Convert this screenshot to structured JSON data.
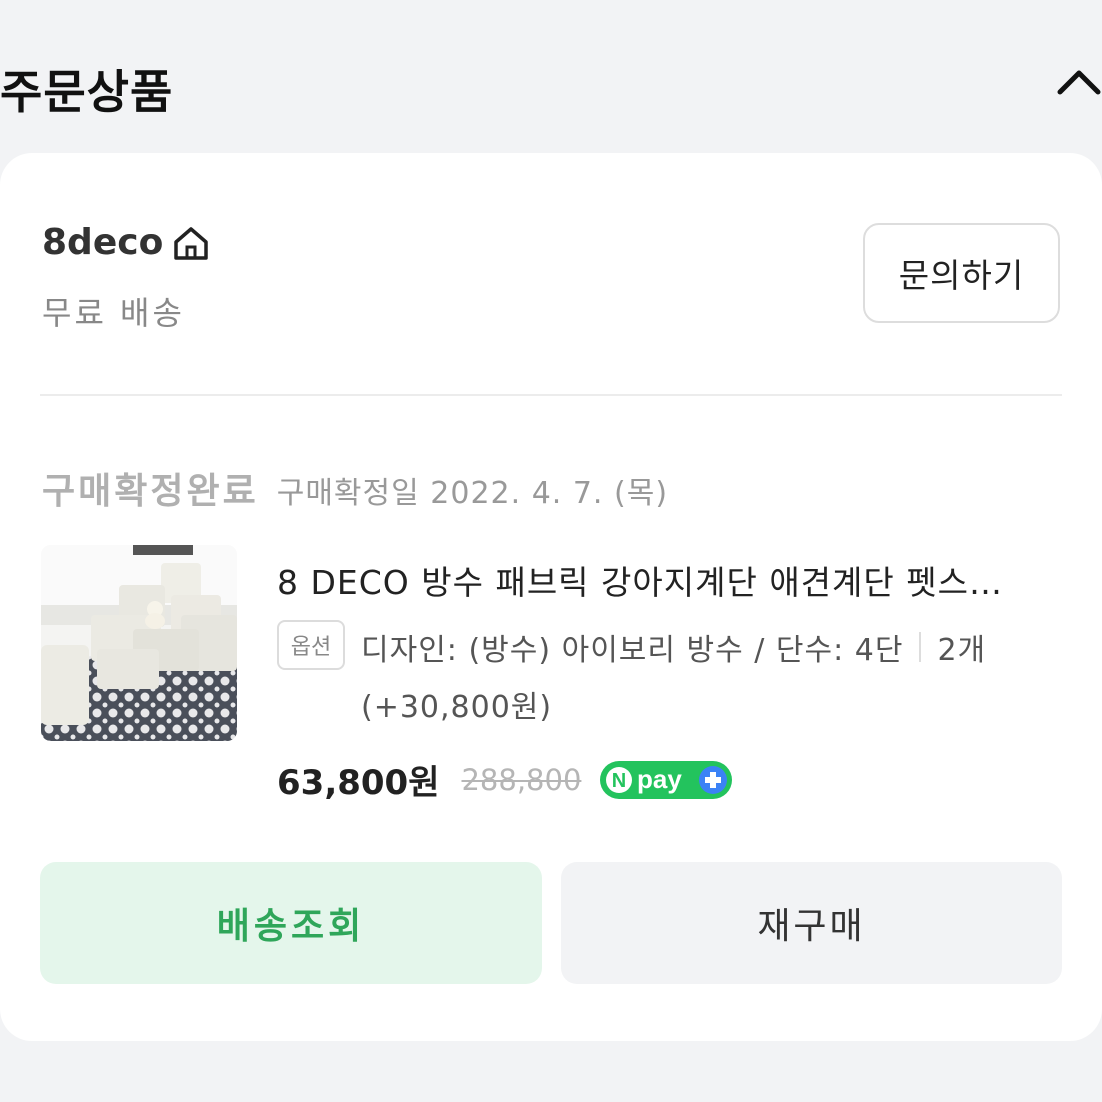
{
  "section": {
    "title": "주문상품"
  },
  "seller": {
    "name": "8deco",
    "shipping": "무료 배송",
    "inquiry_label": "문의하기"
  },
  "order": {
    "status": "구매확정완료",
    "confirm_date": "구매확정일 2022. 4. 7. (목)"
  },
  "product": {
    "name": "8 DECO 방수 패브릭 강아지계단 애견계단 펫스…",
    "option_badge": "옵션",
    "option_text": "디자인: (방수) 아이보리 방수 / 단수: 4단",
    "quantity": "2개",
    "option_price": "(+30,800원)",
    "price": "63,800원",
    "original_price": "288,800",
    "npay_label": "pay"
  },
  "actions": {
    "track_label": "배송조회",
    "rebuy_label": "재구매"
  },
  "colors": {
    "accent_green": "#2fa65a",
    "track_bg": "#e4f6eb",
    "npay_green": "#23c35d",
    "npay_blue": "#3b82f6"
  },
  "icons": {
    "collapse": "chevron-up-icon",
    "home": "home-icon",
    "npay": "npay-plus-logo"
  }
}
